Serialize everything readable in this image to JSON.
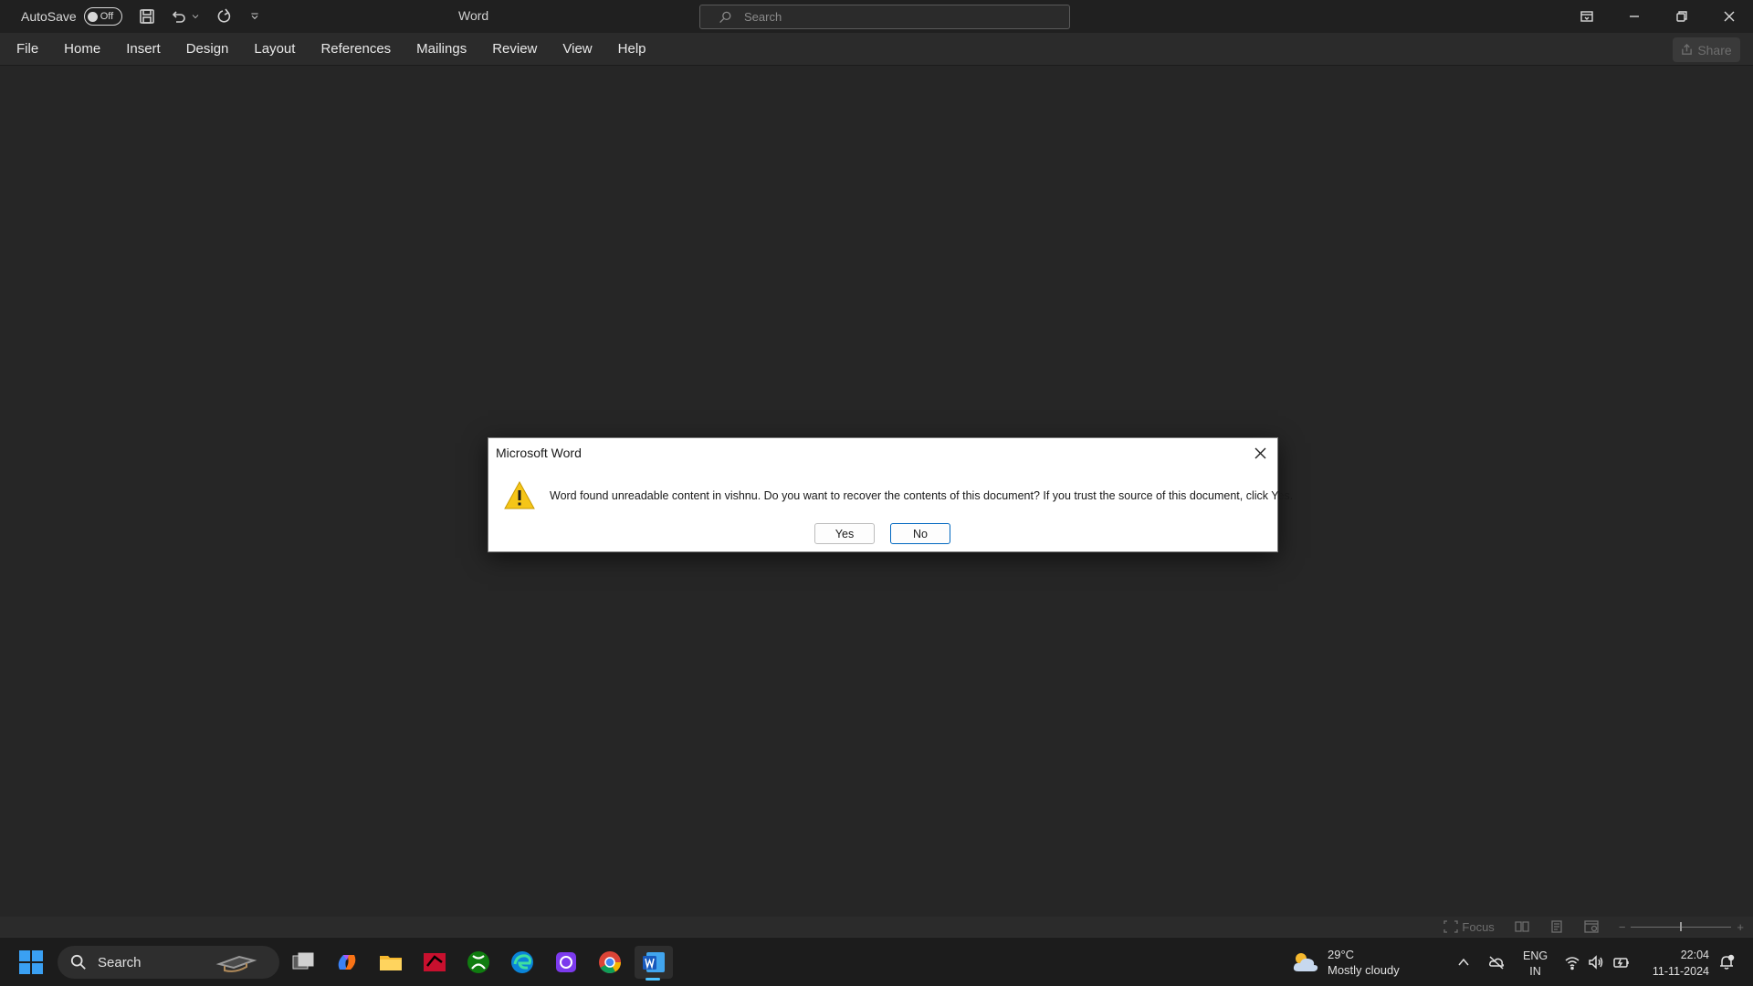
{
  "titlebar": {
    "autosave_label": "AutoSave",
    "autosave_state": "Off",
    "app_title": "Word",
    "search_placeholder": "Search"
  },
  "menu": {
    "items": [
      "File",
      "Home",
      "Insert",
      "Design",
      "Layout",
      "References",
      "Mailings",
      "Review",
      "View",
      "Help"
    ],
    "share_label": "Share"
  },
  "statusbar": {
    "focus_label": "Focus"
  },
  "dialog": {
    "title": "Microsoft Word",
    "message": "Word found unreadable content in vishnu. Do you want to recover the contents of this document? If you trust the source of this document, click Yes.",
    "yes_label": "Yes",
    "no_label": "No"
  },
  "taskbar": {
    "search_label": "Search",
    "weather_temp": "29°C",
    "weather_desc": "Mostly cloudy",
    "lang_1": "ENG",
    "lang_2": "IN",
    "time": "22:04",
    "date": "11-11-2024"
  },
  "colors": {
    "accent": "#0067c0",
    "active_indicator": "#4cc2ff",
    "background": "#262626",
    "warning": "#f5c518"
  }
}
